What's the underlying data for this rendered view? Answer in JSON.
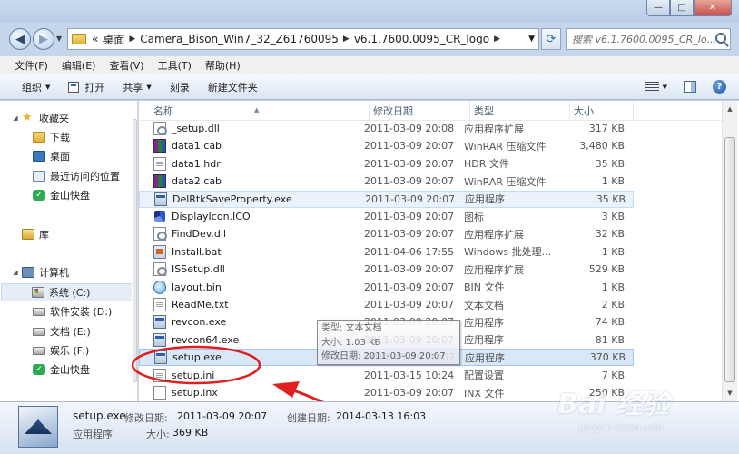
{
  "window": {
    "minimize": "—",
    "maximize": "□",
    "close": "✕"
  },
  "address": {
    "overflow": "«",
    "crumbs": [
      "桌面",
      "Camera_Bison_Win7_32_Z61760095",
      "v6.1.7600.0095_CR_logo"
    ],
    "search_placeholder": "搜索 v6.1.7600.0095_CR_lo..."
  },
  "menu": [
    "文件(F)",
    "编辑(E)",
    "查看(V)",
    "工具(T)",
    "帮助(H)"
  ],
  "toolbar": {
    "organize": "组织",
    "open": "打开",
    "share": "共享",
    "burn": "刻录",
    "new_folder": "新建文件夹"
  },
  "nav": {
    "favorites": "收藏夹",
    "downloads": "下载",
    "desktop": "桌面",
    "recent": "最近访问的位置",
    "jinshan1": "金山快盘",
    "libraries": "库",
    "computer": "计算机",
    "drive_c": "系统 (C:)",
    "drive_d": "软件安装 (D:)",
    "drive_e": "文档 (E:)",
    "drive_f": "娱乐 (F:)",
    "jinshan2": "金山快盘"
  },
  "columns": {
    "name": "名称",
    "date": "修改日期",
    "type": "类型",
    "size": "大小"
  },
  "files": [
    {
      "name": "_setup.dll",
      "date": "2011-03-09 20:08",
      "type": "应用程序扩展",
      "size": "317 KB",
      "icon": "dll"
    },
    {
      "name": "data1.cab",
      "date": "2011-03-09 20:07",
      "type": "WinRAR 压缩文件",
      "size": "3,480 KB",
      "icon": "rar"
    },
    {
      "name": "data1.hdr",
      "date": "2011-03-09 20:07",
      "type": "HDR 文件",
      "size": "35 KB",
      "icon": "txt"
    },
    {
      "name": "data2.cab",
      "date": "2011-03-09 20:07",
      "type": "WinRAR 压缩文件",
      "size": "1 KB",
      "icon": "rar"
    },
    {
      "name": "DelRtkSaveProperty.exe",
      "date": "2011-03-09 20:07",
      "type": "应用程序",
      "size": "35 KB",
      "icon": "exe"
    },
    {
      "name": "DisplayIcon.ICO",
      "date": "2011-03-09 20:07",
      "type": "图标",
      "size": "3 KB",
      "icon": "ico"
    },
    {
      "name": "FindDev.dll",
      "date": "2011-03-09 20:07",
      "type": "应用程序扩展",
      "size": "32 KB",
      "icon": "dll"
    },
    {
      "name": "Install.bat",
      "date": "2011-04-06 17:55",
      "type": "Windows 批处理...",
      "size": "1 KB",
      "icon": "bat"
    },
    {
      "name": "ISSetup.dll",
      "date": "2011-03-09 20:07",
      "type": "应用程序扩展",
      "size": "529 KB",
      "icon": "dll"
    },
    {
      "name": "layout.bin",
      "date": "2011-03-09 20:07",
      "type": "BIN 文件",
      "size": "1 KB",
      "icon": "bin"
    },
    {
      "name": "ReadMe.txt",
      "date": "2011-03-09 20:07",
      "type": "文本文档",
      "size": "2 KB",
      "icon": "txt"
    },
    {
      "name": "revcon.exe",
      "date": "2011-03-09 20:07",
      "type": "应用程序",
      "size": "74 KB",
      "icon": "exe"
    },
    {
      "name": "revcon64.exe",
      "date": "2011-03-09 20:07",
      "type": "应用程序",
      "size": "81 KB",
      "icon": "exe"
    },
    {
      "name": "setup.exe",
      "date": "2011-03-09 20:07",
      "type": "应用程序",
      "size": "370 KB",
      "icon": "exe"
    },
    {
      "name": "setup.ini",
      "date": "2011-03-15 10:24",
      "type": "配置设置",
      "size": "7 KB",
      "icon": "txt"
    },
    {
      "name": "setup.inx",
      "date": "2011-03-09 20:07",
      "type": "INX 文件",
      "size": "250 KB",
      "icon": "inx"
    }
  ],
  "tooltip": {
    "line1": "类型: 文本文档",
    "line2": "大小: 1.03 KB",
    "line3": "修改日期: 2011-03-09 20:07"
  },
  "details": {
    "name": "setup.exe",
    "modified_label": "修改日期:",
    "modified": "2011-03-09 20:07",
    "created_label": "创建日期:",
    "created": "2014-03-13 16:03",
    "type": "应用程序",
    "size_label": "大小:",
    "size": "369 KB"
  },
  "watermark": {
    "logo": "Bai 经验",
    "url": "jingyan.baidu.com"
  },
  "colors": {
    "selection": "#d9e8f9",
    "annotation": "#e02020"
  }
}
